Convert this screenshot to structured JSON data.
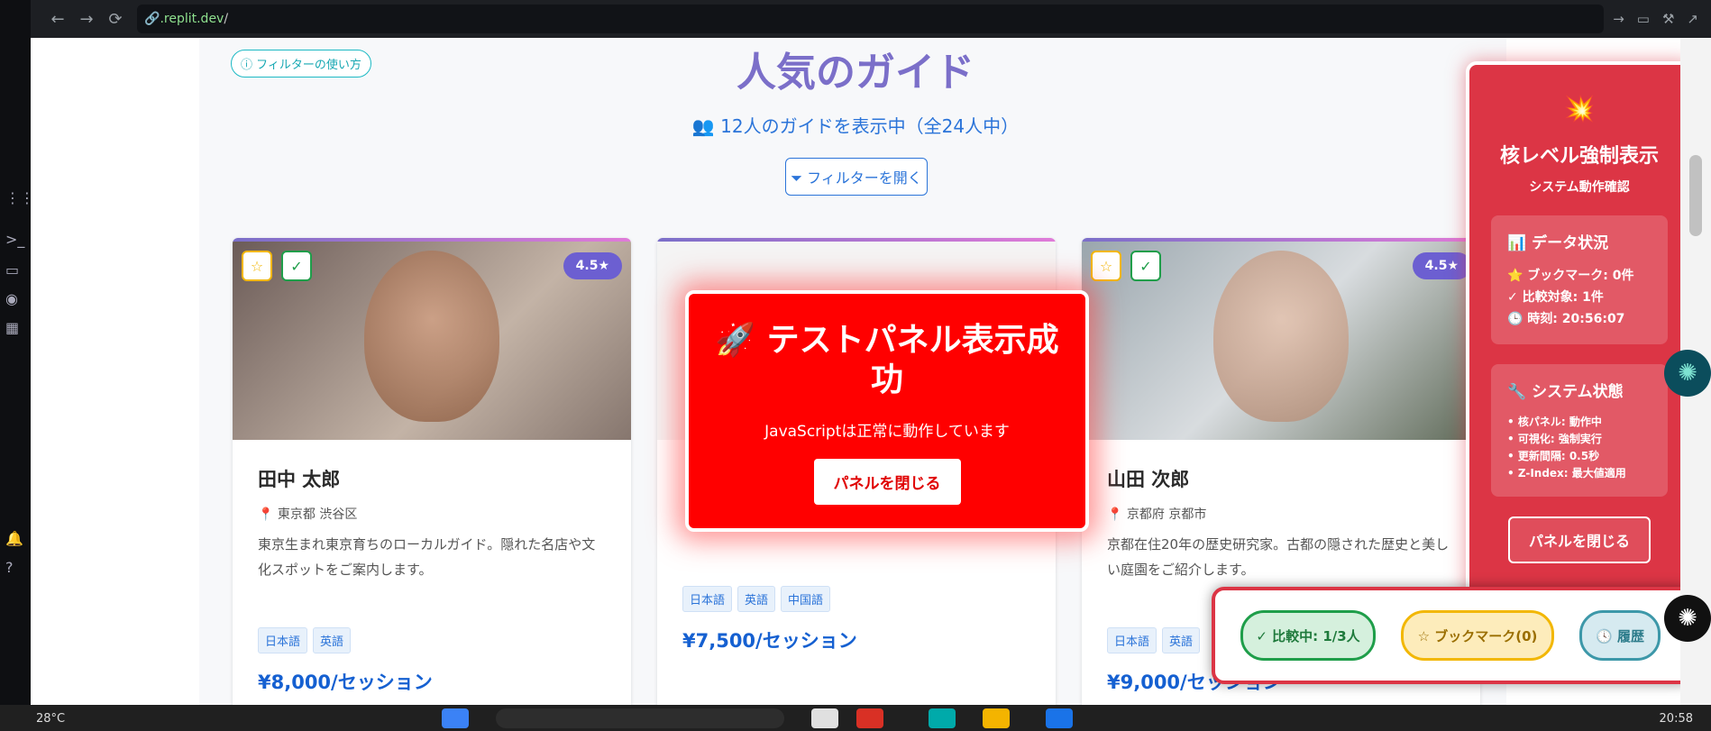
{
  "browser": {
    "url_prefix": "🔗",
    "url_host": ".replit.dev",
    "url_path": "/"
  },
  "page": {
    "filter_help": "ⓘ フィルターの使い方",
    "title": "人気のガイド",
    "count_text": "👥 12人のガイドを表示中（全24人中）",
    "open_filter": "⏷ フィルターを開く"
  },
  "cards": [
    {
      "name": "田中 太郎",
      "location": "東京都 渋谷区",
      "description": "東京生まれ東京育ちのローカルガイド。隠れた名店や文化スポットをご案内します。",
      "languages": [
        "日本語",
        "英語"
      ],
      "price": "¥8,000/セッション",
      "rating": "4.5★"
    },
    {
      "name": "",
      "location": "",
      "description": "",
      "languages": [
        "日本語",
        "英語",
        "中国語"
      ],
      "price": "¥7,500/セッション",
      "rating": ""
    },
    {
      "name": "山田 次郎",
      "location": "京都府 京都市",
      "description": "京都在住20年の歴史研究家。古都の隠された歴史と美しい庭園をご紹介します。",
      "languages": [
        "日本語",
        "英語"
      ],
      "price": "¥9,000/セッション",
      "rating": "4.5★"
    }
  ],
  "test_panel": {
    "title": "🚀 テストパネル表示成功",
    "subtitle": "JavaScriptは正常に動作しています",
    "close": "パネルを閉じる"
  },
  "nuke_panel": {
    "icon": "💥",
    "title": "核レベル強制表示",
    "subtitle": "システム動作確認",
    "data_heading": "📊 データ状況",
    "data_lines": [
      "⭐ ブックマーク: 0件",
      "✓ 比較対象: 1件",
      "🕒 時刻: 20:56:07"
    ],
    "system_heading": "🔧 システム状態",
    "system_lines": [
      "• 核パネル: 動作中",
      "• 可視化: 強制実行",
      "• 更新間隔: 0.5秒",
      "• Z-Index: 最大値適用"
    ],
    "close": "パネルを閉じる"
  },
  "bottom_bar": {
    "compare": "✓ 比較中: 1/3人",
    "bookmark": "☆ ブックマーク(0)",
    "history": "🕓 履歴"
  },
  "taskbar": {
    "temp": "28°C",
    "clock": "20:58"
  },
  "colors": {
    "accent": "#2b74d9",
    "title": "#7b6fc9",
    "danger": "#dc3545",
    "test_red": "#ff0000"
  }
}
